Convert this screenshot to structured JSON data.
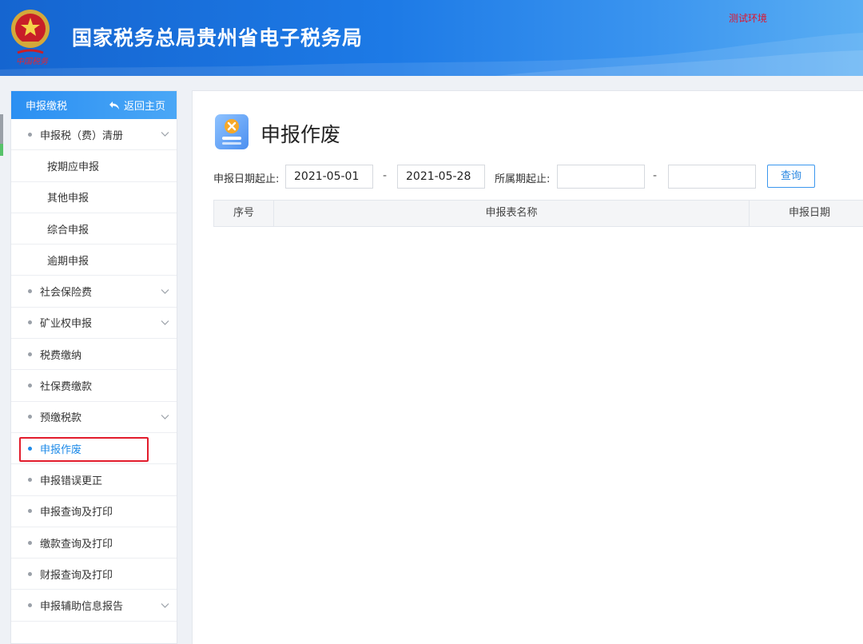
{
  "header": {
    "title": "国家税务总局贵州省电子税务局",
    "env_label": "测试环境",
    "emblem_motto": "中国税务",
    "brand_color": "#1d7ae6"
  },
  "sidebar": {
    "section_title": "申报缴税",
    "back_label": "返回主页",
    "back_icon": "return-arrow-icon",
    "items": [
      {
        "label": "申报税（费）清册",
        "level": 1,
        "expandable": true
      },
      {
        "label": "按期应申报",
        "level": 2
      },
      {
        "label": "其他申报",
        "level": 2
      },
      {
        "label": "综合申报",
        "level": 2
      },
      {
        "label": "逾期申报",
        "level": 2
      },
      {
        "label": "社会保险费",
        "level": 1,
        "expandable": true
      },
      {
        "label": "矿业权申报",
        "level": 1,
        "expandable": true
      },
      {
        "label": "税费缴纳",
        "level": 1
      },
      {
        "label": "社保费缴款",
        "level": 1
      },
      {
        "label": "预缴税款",
        "level": 1,
        "expandable": true
      },
      {
        "label": "申报作废",
        "level": 1,
        "active": true
      },
      {
        "label": "申报错误更正",
        "level": 1
      },
      {
        "label": "申报查询及打印",
        "level": 1
      },
      {
        "label": "缴款查询及打印",
        "level": 1
      },
      {
        "label": "财报查询及打印",
        "level": 1
      },
      {
        "label": "申报辅助信息报告",
        "level": 1,
        "expandable": true
      }
    ],
    "active_color": "#1e8ae8",
    "highlight_color": "#e21c2c"
  },
  "main": {
    "page_title": "申报作废",
    "page_icon": "cancel-document-icon",
    "filters": {
      "declare_date_label": "申报日期起止:",
      "declare_date_start": "2021-05-01",
      "declare_date_end": "2021-05-28",
      "range_separator": "-",
      "period_label": "所属期起止:",
      "period_start": "",
      "period_end": ""
    },
    "query_button": "查询",
    "table": {
      "columns": [
        "序号",
        "申报表名称",
        "申报日期"
      ],
      "rows": []
    }
  }
}
